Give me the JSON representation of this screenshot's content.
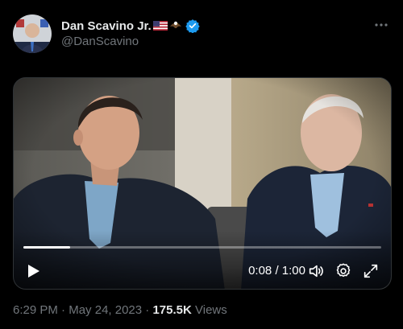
{
  "author": {
    "display_name": "Dan Scavino Jr.",
    "handle": "@DanScavino",
    "verified": true,
    "name_emojis": [
      "us-flag-emoji",
      "eagle-emoji"
    ]
  },
  "video": {
    "current_time": "0:08",
    "duration": "1:00",
    "time_separator": " / ",
    "progress_fraction": 0.13
  },
  "meta": {
    "time": "6:29 PM",
    "separator": " · ",
    "date": "May 24, 2023",
    "views_count": "175.5K",
    "views_label": "Views"
  },
  "icons": {
    "more": "more-horizontal-icon",
    "play": "play-icon",
    "volume": "volume-icon",
    "settings": "settings-icon",
    "fullscreen": "fullscreen-icon"
  },
  "colors": {
    "background": "#000000",
    "primary_text": "#e7e9ea",
    "secondary_text": "#71767b",
    "verified_blue": "#1d9bf0"
  }
}
